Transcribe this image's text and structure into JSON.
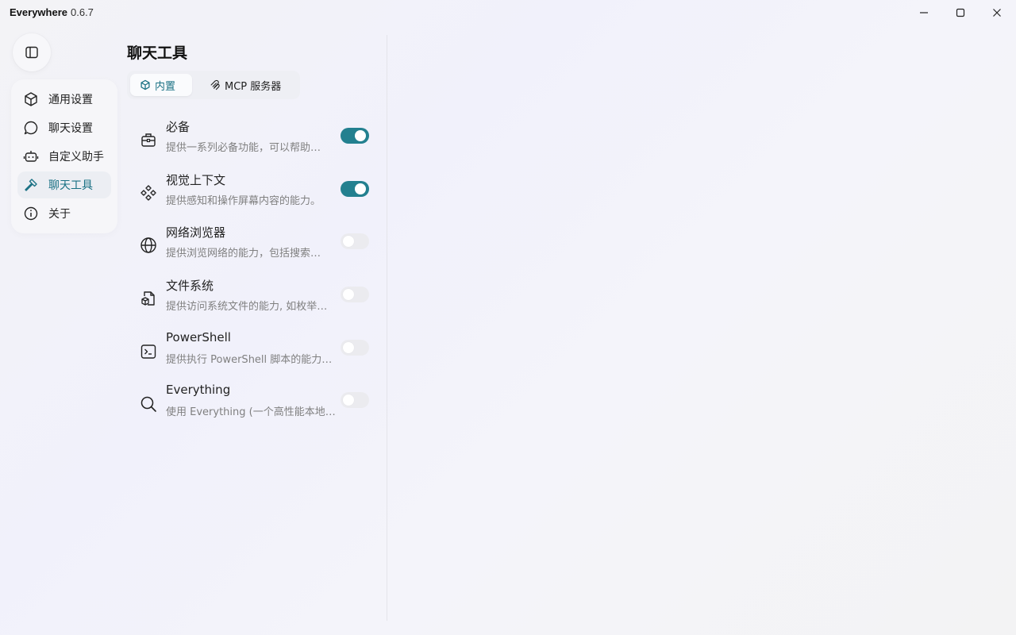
{
  "app": {
    "name": "Everywhere",
    "version": "0.6.7"
  },
  "window_controls": {
    "minimize": "minimize",
    "maximize": "maximize",
    "close": "close"
  },
  "nav": {
    "items": [
      {
        "label": "通用设置",
        "icon": "cube-icon",
        "active": false
      },
      {
        "label": "聊天设置",
        "icon": "chat-bubble-icon",
        "active": false
      },
      {
        "label": "自定义助手",
        "icon": "robot-icon",
        "active": false
      },
      {
        "label": "聊天工具",
        "icon": "hammer-icon",
        "active": true
      },
      {
        "label": "关于",
        "icon": "info-icon",
        "active": false
      }
    ]
  },
  "panel": {
    "title": "聊天工具",
    "tabs": [
      {
        "label": "内置",
        "icon": "cube-icon",
        "active": true
      },
      {
        "label": "MCP 服务器",
        "icon": "mcp-icon",
        "active": false
      }
    ],
    "tools": [
      {
        "name": "必备",
        "desc": "提供一系列必备功能，可以帮助…",
        "icon": "toolbox-icon",
        "enabled": true
      },
      {
        "name": "视觉上下文",
        "desc": "提供感知和操作屏幕内容的能力。",
        "icon": "diamonds-icon",
        "enabled": true
      },
      {
        "name": "网络浏览器",
        "desc": "提供浏览网络的能力，包括搜索…",
        "icon": "globe-icon",
        "enabled": false
      },
      {
        "name": "文件系统",
        "desc": "提供访问系统文件的能力, 如枚举…",
        "icon": "file-cube-icon",
        "enabled": false
      },
      {
        "name": "PowerShell",
        "desc": "提供执行 PowerShell 脚本的能力…",
        "icon": "terminal-icon",
        "enabled": false
      },
      {
        "name": "Everything",
        "desc": "使用 Everything (一个高性能本地…",
        "icon": "search-icon",
        "enabled": false
      }
    ]
  },
  "colors": {
    "accent": "#23808f",
    "accent_text": "#1a7184"
  }
}
